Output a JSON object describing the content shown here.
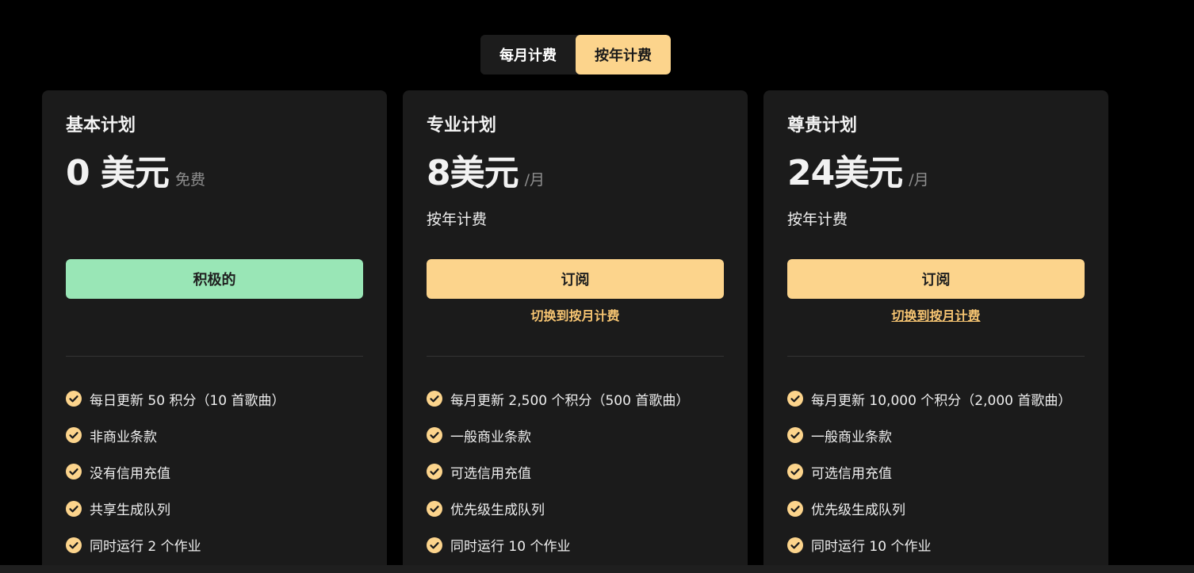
{
  "billing_toggle": {
    "monthly_label": "每月计费",
    "yearly_label": "按年计费",
    "selected": "yearly"
  },
  "colors": {
    "background": "#000000",
    "card": "#1b1b1b",
    "accent_gold": "#fcd48c",
    "accent_green": "#99e6b6",
    "link_gold": "#f7c572"
  },
  "plans": [
    {
      "title": "基本计划",
      "price": "0 美元",
      "price_unit": "免费",
      "billing_note": "",
      "button_label": "积极的",
      "switch_link": "",
      "features": [
        "每日更新 50 积分（10 首歌曲）",
        "非商业条款",
        "没有信用充值",
        "共享生成队列",
        "同时运行 2 个作业"
      ]
    },
    {
      "title": "专业计划",
      "price": "8美元",
      "price_unit": "/月",
      "billing_note": "按年计费",
      "button_label": "订阅",
      "switch_link": "切换到按月计费",
      "features": [
        "每月更新 2,500 个积分（500 首歌曲）",
        "一般商业条款",
        "可选信用充值",
        "优先级生成队列",
        "同时运行 10 个作业"
      ]
    },
    {
      "title": "尊贵计划",
      "price": "24美元",
      "price_unit": "/月",
      "billing_note": "按年计费",
      "button_label": "订阅",
      "switch_link": "切换到按月计费",
      "features": [
        "每月更新 10,000 个积分（2,000 首歌曲）",
        "一般商业条款",
        "可选信用充值",
        "优先级生成队列",
        "同时运行 10 个作业"
      ]
    }
  ],
  "icons": {
    "feature_check": "check-circle-icon"
  }
}
